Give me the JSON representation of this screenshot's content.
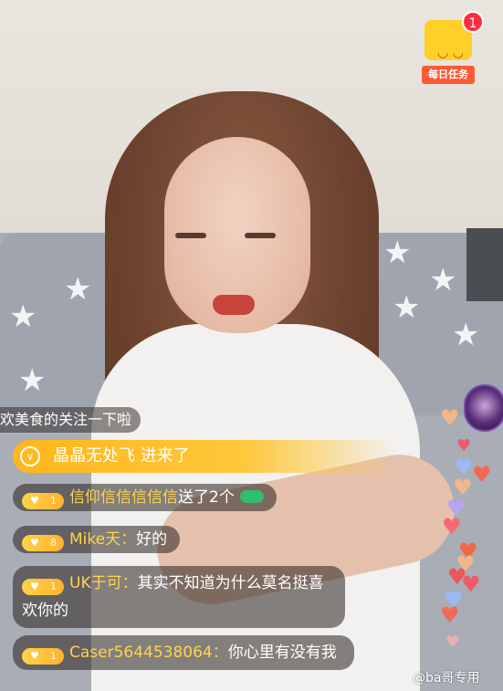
{
  "task_widget": {
    "label": "每日任务",
    "badge": "1",
    "icon": "gift-box-face-icon"
  },
  "chat": {
    "partial_top": "欢美食的关注一下啦",
    "enter_notice": {
      "user": "晶晶无处飞",
      "text": "进来了"
    },
    "messages": [
      {
        "level": "1",
        "user": "信仰信信信信信",
        "text": "送了2个",
        "gift": "green-gift-icon"
      },
      {
        "level": "8",
        "user": "Mike天",
        "text": "好的"
      },
      {
        "level": "1",
        "user": "UK于可",
        "text": "其实不知道为什么莫名挺喜欢你的"
      },
      {
        "level": "1",
        "user": "Caser5644538064",
        "text": "你心里有没有我"
      }
    ]
  },
  "watermark": "@ba哥专用",
  "colors": {
    "username": "#ffd34c",
    "enter_bar": "#ffc73a",
    "task_bg": "#ffd028",
    "task_label": "#ff5a36",
    "badge": "#ff2d3d"
  }
}
